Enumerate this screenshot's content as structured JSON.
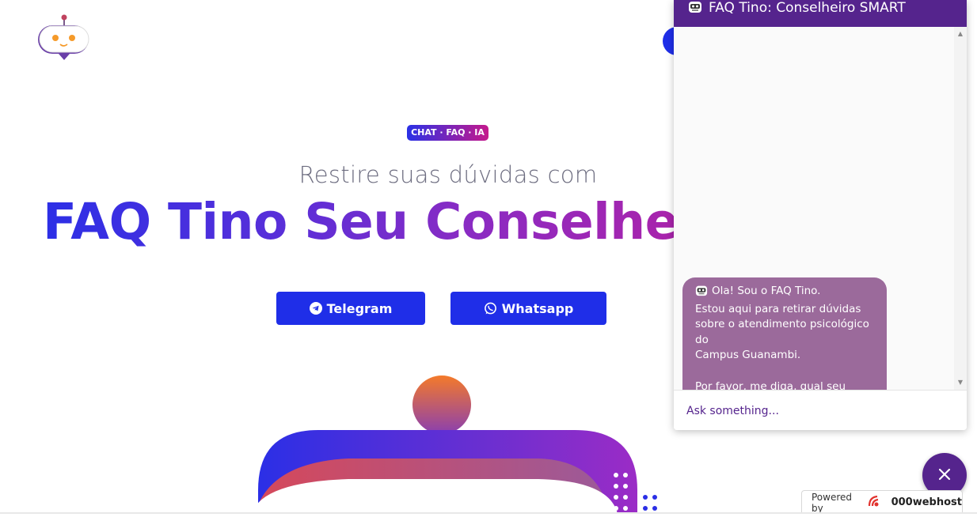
{
  "hero": {
    "badge": "CHAT · FAQ · IA",
    "subtitle": "Restire suas dúvidas com",
    "headline": "FAQ Tino Seu Conselheiro"
  },
  "buttons": {
    "telegram": "Telegram",
    "whatsapp": "Whatsapp"
  },
  "chat": {
    "title": "FAQ Tino: Conselheiro SMART",
    "messages": [
      {
        "lines": [
          "Ola! Sou o FAQ Tino.",
          "Estou aqui para retirar dúvidas",
          "sobre o atendimento psicológico do",
          "Campus Guanambi."
        ],
        "followup": "Por favor, me diga, qual seu nome?"
      }
    ],
    "input_placeholder": "Ask something..."
  },
  "footer": {
    "powered_label": "Powered by",
    "powered_brand": "000webhost"
  },
  "colors": {
    "brand_blue": "#1f2ee8",
    "chat_purple": "#55248d",
    "bubble": "#9b6a9b"
  },
  "icons": {
    "logo": "robot-logo-icon",
    "telegram": "telegram-icon",
    "whatsapp": "whatsapp-icon",
    "chat_avatar": "bot-avatar-icon",
    "close": "close-icon"
  }
}
